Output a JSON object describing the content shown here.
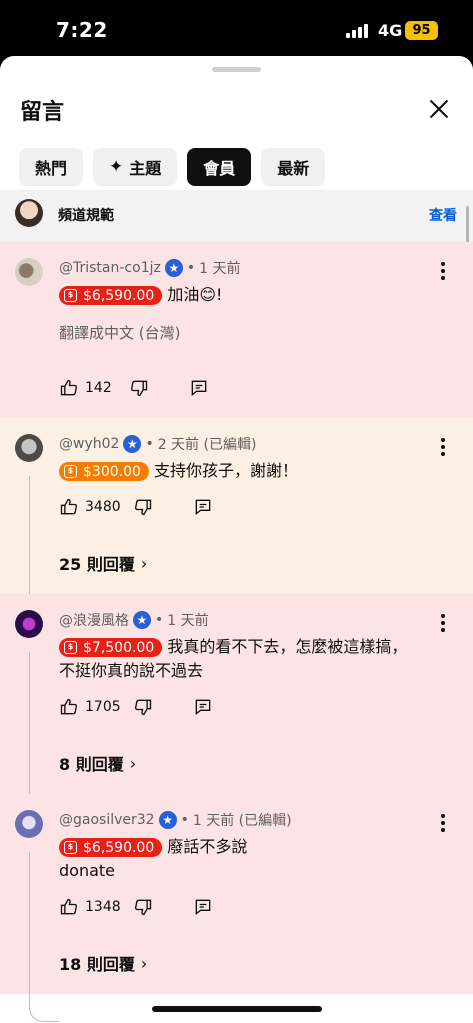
{
  "status_bar": {
    "time": "7:22",
    "network": "4G",
    "battery": "95"
  },
  "sheet": {
    "title": "留言"
  },
  "tabs": [
    {
      "label": "熱門",
      "active": false
    },
    {
      "label": "主題",
      "active": false,
      "icon": "sparkle-icon"
    },
    {
      "label": "會員",
      "active": true
    },
    {
      "label": "最新",
      "active": false
    }
  ],
  "guidelines": {
    "label": "頻道規範",
    "link": "查看"
  },
  "comments": [
    {
      "author": "@Tristan-co1jz",
      "time": "1 天前",
      "amount": "$6,590.00",
      "amount_color": "#e62117",
      "bg": "#fce4e4",
      "text": "加油😊!",
      "translate": "翻譯成中文 (台灣)",
      "likes": "142"
    },
    {
      "author": "@wyh02",
      "time": "2 天前 (已編輯)",
      "amount": "$300.00",
      "amount_color": "#f57c00",
      "bg": "#fcf0e4",
      "text": "支持你孩子，謝謝！",
      "likes": "3480",
      "replies": "25 則回覆"
    },
    {
      "author": "@浪漫風格",
      "time": "1 天前",
      "amount": "$7,500.00",
      "amount_color": "#e62117",
      "bg": "#fce4e4",
      "text": "我真的看不下去，怎麼被這樣搞，",
      "text2": "不挺你真的說不過去",
      "likes": "1705",
      "replies": "8 則回覆"
    },
    {
      "author": "@gaosilver32",
      "time": "1 天前 (已編輯)",
      "amount": "$6,590.00",
      "amount_color": "#e62117",
      "bg": "#fce4e4",
      "text": "廢話不多說",
      "text2": "donate",
      "likes": "1348",
      "replies": "18 則回覆"
    }
  ]
}
